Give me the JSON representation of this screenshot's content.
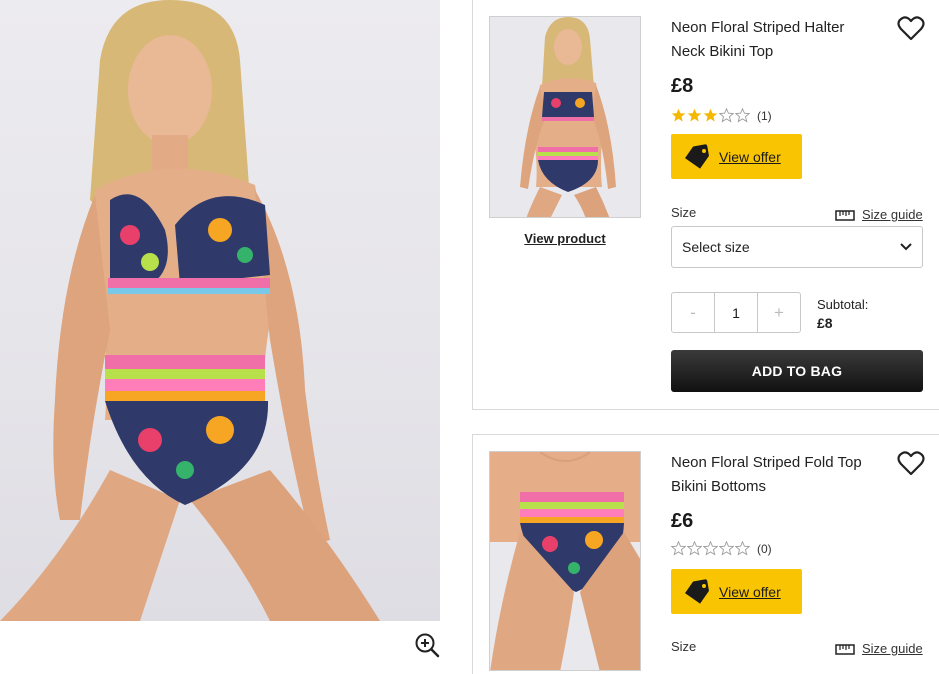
{
  "products": [
    {
      "title": "Neon Floral Striped Halter Neck Bikini Top",
      "price": "£8",
      "rating": 3,
      "review_count": "(1)",
      "offer_label": "View offer",
      "view_product_label": "View product",
      "size_label": "Size",
      "size_guide_label": "Size guide",
      "size_select_value": "Select size",
      "quantity": "1",
      "qty_minus": "-",
      "qty_plus": "+",
      "subtotal_label": "Subtotal:",
      "subtotal_value": "£8",
      "add_to_bag_label": "ADD TO BAG"
    },
    {
      "title": "Neon Floral Striped Fold Top Bikini Bottoms",
      "price": "£6",
      "rating": 0,
      "review_count": "(0)",
      "offer_label": "View offer",
      "size_label": "Size",
      "size_guide_label": "Size guide"
    }
  ],
  "colors": {
    "offer_yellow": "#f9c502",
    "star_gold": "#f5b800",
    "button_dark": "#1a1a1a"
  },
  "icons": [
    "zoom-in-icon",
    "heart-icon",
    "price-tag-icon",
    "ruler-icon",
    "chevron-down-icon",
    "star-icon"
  ]
}
